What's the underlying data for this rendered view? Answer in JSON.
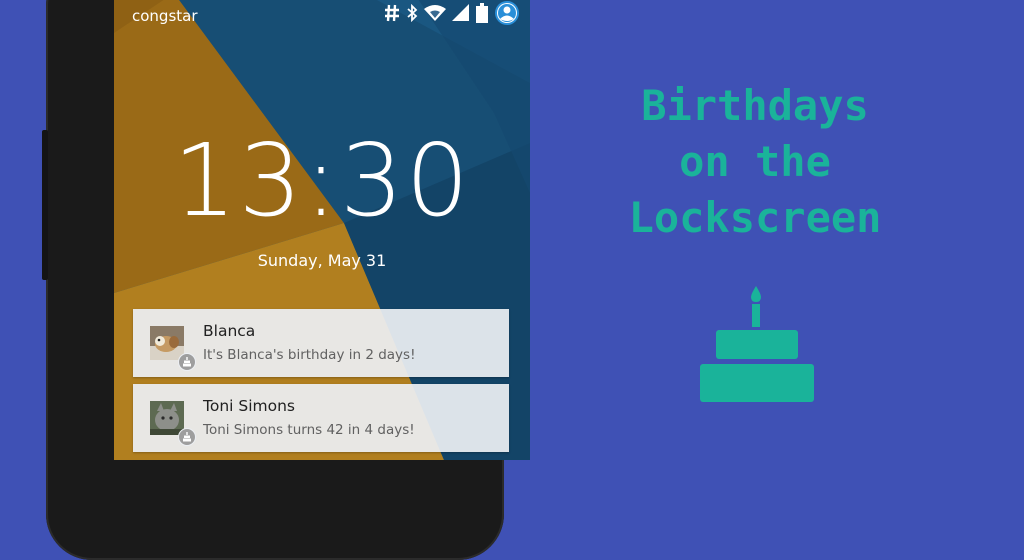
{
  "status_bar": {
    "carrier": "congstar",
    "icons": [
      "hash-icon",
      "bluetooth-icon",
      "wifi-icon",
      "cell-signal-icon",
      "battery-icon",
      "account-icon"
    ]
  },
  "lockscreen": {
    "time": "13:30",
    "date": "Sunday, May 31"
  },
  "notifications": [
    {
      "name": "Blanca",
      "message": "It's Blanca's birthday in 2 days!",
      "icon": "cake-icon"
    },
    {
      "name": "Toni Simons",
      "message": "Toni Simons turns 42 in 4 days!",
      "icon": "cake-icon"
    }
  ],
  "promo": {
    "headline_lines": [
      "Birthdays",
      "on the",
      "Lockscreen"
    ],
    "icon": "birthday-cake-icon"
  },
  "colors": {
    "background": "#3f51b5",
    "accent": "#1ab39a",
    "wallpaper_blue": "#1f5c85",
    "wallpaper_orange": "#b07a1c"
  }
}
